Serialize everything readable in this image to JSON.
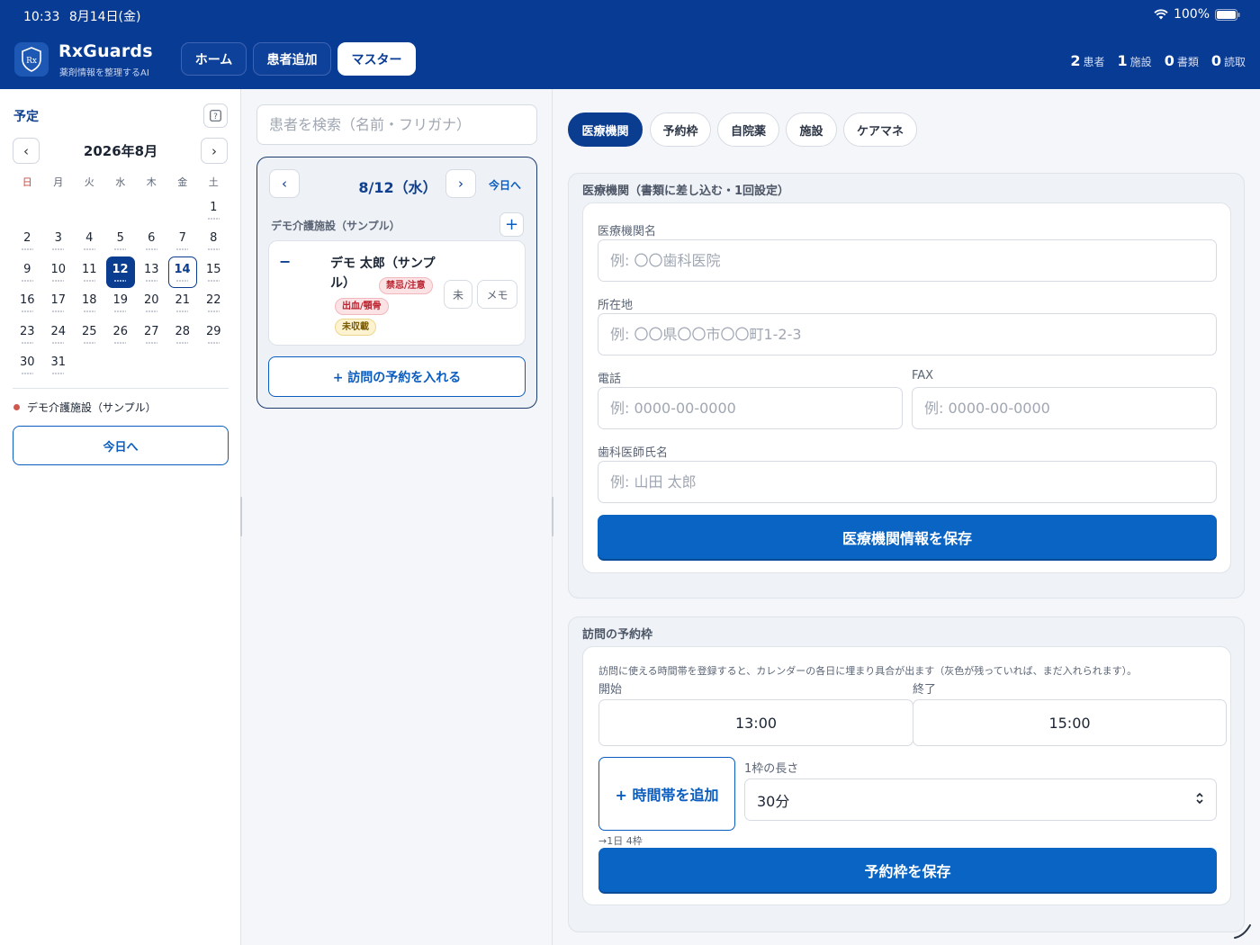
{
  "status": {
    "time": "10:33",
    "date": "8月14日(金)",
    "battery": "100%"
  },
  "header": {
    "brand": "RxGuards",
    "tagline": "薬剤情報を整理するAI",
    "logo_text": "Rx",
    "nav": [
      {
        "label": "ホーム",
        "active": false
      },
      {
        "label": "患者追加",
        "active": false
      },
      {
        "label": "マスター",
        "active": true
      }
    ],
    "stats": [
      {
        "num": "2",
        "label": "患者"
      },
      {
        "num": "1",
        "label": "施設"
      },
      {
        "num": "0",
        "label": "書類"
      },
      {
        "num": "0",
        "label": "読取"
      }
    ]
  },
  "calendar": {
    "title": "予定",
    "month": "2026年8月",
    "prev": "‹",
    "next": "›",
    "weekdays": [
      "日",
      "月",
      "火",
      "水",
      "木",
      "金",
      "土"
    ],
    "leading_blanks": 6,
    "days": 31,
    "selected_day": 12,
    "today_day": 14,
    "facility_legend": "デモ介護施設（サンプル）",
    "today_button": "今日へ"
  },
  "middle": {
    "search_placeholder": "患者を検索（名前・フリガナ）",
    "day_prev": "‹",
    "day_next": "›",
    "day_label": "8/12（水）",
    "today_link": "今日へ",
    "facility": "デモ介護施設（サンプル）",
    "add": "+",
    "patient": {
      "collapse": "−",
      "name": "デモ 太郎（サンプル）",
      "tags": [
        "禁忌/注意",
        "出血/顎骨",
        "未収載"
      ],
      "button_status": "未",
      "button_memo": "メモ"
    },
    "visit_button": "+ 訪問の予約を入れる"
  },
  "right": {
    "tabs": [
      {
        "label": "医療機関",
        "active": true
      },
      {
        "label": "予約枠",
        "active": false
      },
      {
        "label": "自院薬",
        "active": false
      },
      {
        "label": "施設",
        "active": false
      },
      {
        "label": "ケアマネ",
        "active": false
      }
    ],
    "institution": {
      "title": "医療機関（書類に差し込む・1回設定）",
      "name_label": "医療機関名",
      "name_placeholder": "例: 〇〇歯科医院",
      "address_label": "所在地",
      "address_placeholder": "例: 〇〇県〇〇市〇〇町1-2-3",
      "phone_label": "電話",
      "phone_placeholder": "例: 0000-00-0000",
      "fax_label": "FAX",
      "fax_placeholder": "例: 0000-00-0000",
      "dentist_label": "歯科医師氏名",
      "dentist_placeholder": "例: 山田 太郎",
      "save_button": "医療機関情報を保存"
    },
    "slots": {
      "title": "訪問の予約枠",
      "hint": "訪問に使える時間帯を登録すると、カレンダーの各日に埋まり具合が出ます（灰色が残っていれば、まだ入れられます）。",
      "start_label": "開始",
      "end_label": "終了",
      "start_value": "13:00",
      "end_value": "15:00",
      "add_button": "+ 時間帯を追加",
      "length_label": "1枠の長さ",
      "length_value": "30分",
      "per_day": "→1日 4枠",
      "save_button": "予約枠を保存"
    }
  }
}
